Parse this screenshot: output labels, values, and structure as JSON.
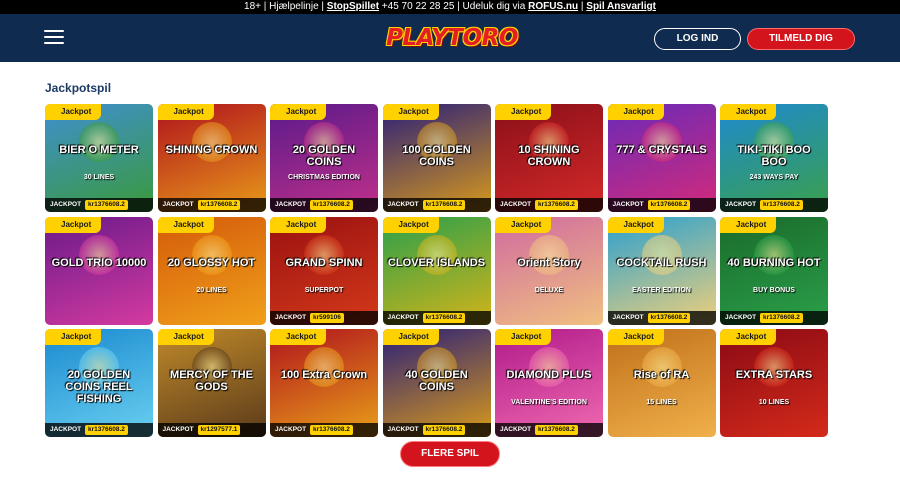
{
  "topbar": {
    "prefix": "18+ | Hjælpelinje | ",
    "stopspillet": "StopSpillet",
    "middle": " +45 70 22 28 25 | Udeluk dig via ",
    "rofus": "ROFUS.nu",
    "sep": " | ",
    "ansvarligt": "Spil Ansvarligt"
  },
  "header": {
    "logo": "PLAYTORO",
    "login_label": "LOG IND",
    "signup_label": "TILMELD DIG"
  },
  "section": {
    "title": "Jackpotspil"
  },
  "games": [
    {
      "name": "BIER O METER",
      "sub": "30 LINES",
      "badge": "Jackpot",
      "jackpot_label": "JACKPOT",
      "amount": "kr1376608.2",
      "bg": "#3f8fd0",
      "bg2": "#3a9a3a"
    },
    {
      "name": "SHINING CROWN",
      "sub": "",
      "badge": "Jackpot",
      "jackpot_label": "JACKPOT",
      "amount": "kr1376608.2",
      "bg": "#b0121c",
      "bg2": "#e89a1a"
    },
    {
      "name": "20 GOLDEN COINS",
      "sub": "CHRISTMAS EDITION",
      "badge": "Jackpot",
      "jackpot_label": "JACKPOT",
      "amount": "kr1376608.2",
      "bg": "#5a1a8a",
      "bg2": "#c0308a"
    },
    {
      "name": "100 GOLDEN COINS",
      "sub": "",
      "badge": "Jackpot",
      "jackpot_label": "JACKPOT",
      "amount": "kr1376608.2",
      "bg": "#2a1f7a",
      "bg2": "#d99a1a"
    },
    {
      "name": "10 SHINING CROWN",
      "sub": "",
      "badge": "Jackpot",
      "jackpot_label": "JACKPOT",
      "amount": "kr1376608.2",
      "bg": "#8a0f18",
      "bg2": "#d42a2a"
    },
    {
      "name": "777 & CRYSTALS",
      "sub": "",
      "badge": "Jackpot",
      "jackpot_label": "JACKPOT",
      "amount": "kr1376608.2",
      "bg": "#6a2ab8",
      "bg2": "#d42a7a"
    },
    {
      "name": "TIKI-TIKI BOO BOO",
      "sub": "243 WAYS PAY",
      "badge": "Jackpot",
      "jackpot_label": "JACKPOT",
      "amount": "kr1376608.2",
      "bg": "#1e8ad0",
      "bg2": "#3aa04a"
    },
    {
      "name": "GOLD TRIO 10000",
      "sub": "",
      "badge": "Jackpot",
      "jackpot_label": "",
      "amount": "",
      "bg": "#6a1a8a",
      "bg2": "#d43aa0"
    },
    {
      "name": "20 GLOSSY HOT",
      "sub": "20 LINES",
      "badge": "Jackpot",
      "jackpot_label": "",
      "amount": "",
      "bg": "#d45a0a",
      "bg2": "#f0a01a"
    },
    {
      "name": "GRAND SPINN",
      "sub": "SUPERPOT",
      "badge": "Jackpot",
      "jackpot_label": "JACKPOT",
      "amount": "kr599106",
      "bg": "#9a1010",
      "bg2": "#d43a1a"
    },
    {
      "name": "CLOVER ISLANDS",
      "sub": "",
      "badge": "Jackpot",
      "jackpot_label": "JACKPOT",
      "amount": "kr1376608.2",
      "bg": "#2aa04a",
      "bg2": "#d4b41a"
    },
    {
      "name": "Orient Story",
      "sub": "DELUXE",
      "badge": "Jackpot",
      "jackpot_label": "",
      "amount": "",
      "bg": "#d06aa0",
      "bg2": "#f0c080"
    },
    {
      "name": "COCKTAIL RUSH",
      "sub": "EASTER EDITION",
      "badge": "Jackpot",
      "jackpot_label": "JACKPOT",
      "amount": "kr1376608.2",
      "bg": "#2aa0d0",
      "bg2": "#f0d07a"
    },
    {
      "name": "40 BURNING HOT",
      "sub": "BUY BONUS",
      "badge": "Jackpot",
      "jackpot_label": "JACKPOT",
      "amount": "kr1376608.2",
      "bg": "#1a6a2a",
      "bg2": "#2aa04a"
    },
    {
      "name": "20 GOLDEN COINS REEL FISHING",
      "sub": "",
      "badge": "Jackpot",
      "jackpot_label": "JACKPOT",
      "amount": "kr1376608.2",
      "bg": "#1a8ad0",
      "bg2": "#6ad0f0"
    },
    {
      "name": "MERCY OF THE GODS",
      "sub": "",
      "badge": "Jackpot",
      "jackpot_label": "JACKPOT",
      "amount": "kr1297577.1",
      "bg": "#c08a2a",
      "bg2": "#5a3a1a"
    },
    {
      "name": "100 Extra Crown",
      "sub": "",
      "badge": "Jackpot",
      "jackpot_label": "JACKPOT",
      "amount": "kr1376608.2",
      "bg": "#b0121c",
      "bg2": "#e8a01a"
    },
    {
      "name": "40 GOLDEN COINS",
      "sub": "",
      "badge": "Jackpot",
      "jackpot_label": "JACKPOT",
      "amount": "kr1376608.2",
      "bg": "#2a1f7a",
      "bg2": "#d99a1a"
    },
    {
      "name": "DIAMOND PLUS",
      "sub": "VALENTINE'S EDITION",
      "badge": "Jackpot",
      "jackpot_label": "JACKPOT",
      "amount": "kr1376608.2",
      "bg": "#b01a8a",
      "bg2": "#f06ab0"
    },
    {
      "name": "Rise of RA",
      "sub": "15 LINES",
      "badge": "Jackpot",
      "jackpot_label": "",
      "amount": "",
      "bg": "#c0701a",
      "bg2": "#f0b04a"
    },
    {
      "name": "EXTRA STARS",
      "sub": "10 LINES",
      "badge": "Jackpot",
      "jackpot_label": "",
      "amount": "",
      "bg": "#8a0a14",
      "bg2": "#d42a1a"
    }
  ],
  "more_button": {
    "label": "FLERE SPIL"
  }
}
